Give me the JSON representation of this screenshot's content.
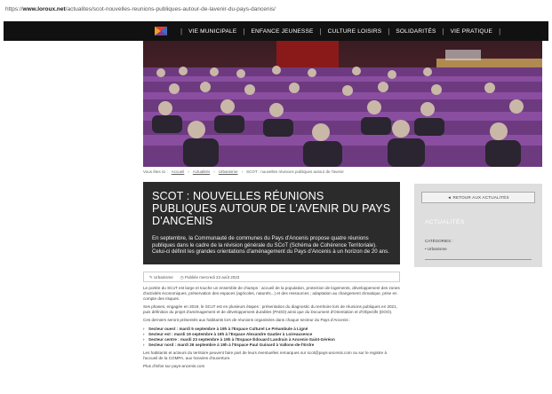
{
  "browser": {
    "url_prefix": "https://",
    "url_domain": "www.loroux.net",
    "url_path": "/actualites/scot-nouvelles-reunions-publiques-autour-de-lavenir-du-pays-dancenis/"
  },
  "nav": {
    "items": [
      "VIE MUNICIPALE",
      "ENFANCE JEUNESSE",
      "CULTURE LOISIRS",
      "SOLIDARITÉS",
      "VIE PRATIQUE"
    ]
  },
  "breadcrumb": {
    "items": [
      "Vous êtes ici :",
      "Accueil",
      "Actualités",
      "Urbanisme",
      "SCOT : nouvelles réunions publiques autour de l'avenir"
    ]
  },
  "article": {
    "title": "SCOT : NOUVELLES RÉUNIONS PUBLIQUES AUTOUR DE L'AVENIR DU PAYS D'ANCENIS",
    "intro": "En septembre, la Communauté de communes du Pays d'Ancenis propose quatre réunions publiques dans le cadre de la révision générale du SCoT (Schéma de Cohérence Territoriale). Celui-ci définit les grandes orientations d'aménagement du Pays d'Ancenis à un horizon de 20 ans.",
    "meta_category": "Urbanisme",
    "meta_date": "Publiée mercredi 23 août 2023",
    "para1": "Le portée du SCoT est large et touche un ensemble de champs : accueil de la population, protection de logements, développement des zones d'activités économiques, préservation des espaces (agricoles, naturels...) et des ressources ; adaptation au changement climatique, prise en compte des risques.",
    "para2": "Ses phases, engagée en 2019, le SCoT est en plusieurs étapes : présentation du diagnostic du territoire lors de réunions publiques en 2021, puis définition du projet d'aménagement et de développement durables (PADD) ainsi que du Document d'Orientation et d'Objectifs (DOO).",
    "para3": "Ces derniers seront présentés aux habitants lors de réunions organisées dans chaque secteur du Pays d'Ancenis :",
    "sectors": [
      "Secteur ouest : mardi 5 septembre à 19h à l'Espace Culturel Le Préambule à Ligné",
      "Secteur est : mardi 19 septembre à 19h à l'Espace Alexandre Gautier à Loireauxence",
      "Secteur centre : mardi 23 septembre à 19h à l'Espace Édouard Landrain à Ancenis-Saint-Géréon",
      "Secteur nord : mardi 26 septembre à 19h à l'Espace Paul Guinard à Vallons-de-l'Erdre"
    ],
    "para4": "Les habitants et acteurs du territoire peuvent faire part de leurs éventuelles remarques sur scot@pays-ancenis.com ou sur le registre à l'accueil de la COMPA, aux horaires d'ouverture.",
    "para5": "Plus d'infos sur pays-ancenis.com"
  },
  "sidebar": {
    "back_button": "◄ RETOUR AUX ACTUALITÉS",
    "title": "ACTUALITÉS",
    "category_label": "CATÉGORIES :",
    "category_item": "• Urbanisme"
  },
  "colors": {
    "nav_bg": "#111111",
    "title_box_bg": "#2b2b2b",
    "sidebar_bg": "#dedede",
    "seat_purple": "#7a3e8e"
  }
}
